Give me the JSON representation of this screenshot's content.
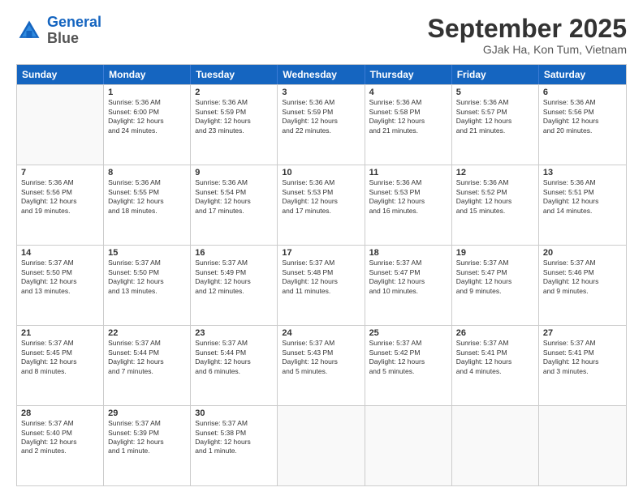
{
  "header": {
    "logo_line1": "General",
    "logo_line2": "Blue",
    "month": "September 2025",
    "location": "GJak Ha, Kon Tum, Vietnam"
  },
  "weekdays": [
    "Sunday",
    "Monday",
    "Tuesday",
    "Wednesday",
    "Thursday",
    "Friday",
    "Saturday"
  ],
  "rows": [
    [
      {
        "day": "",
        "lines": []
      },
      {
        "day": "1",
        "lines": [
          "Sunrise: 5:36 AM",
          "Sunset: 6:00 PM",
          "Daylight: 12 hours",
          "and 24 minutes."
        ]
      },
      {
        "day": "2",
        "lines": [
          "Sunrise: 5:36 AM",
          "Sunset: 5:59 PM",
          "Daylight: 12 hours",
          "and 23 minutes."
        ]
      },
      {
        "day": "3",
        "lines": [
          "Sunrise: 5:36 AM",
          "Sunset: 5:59 PM",
          "Daylight: 12 hours",
          "and 22 minutes."
        ]
      },
      {
        "day": "4",
        "lines": [
          "Sunrise: 5:36 AM",
          "Sunset: 5:58 PM",
          "Daylight: 12 hours",
          "and 21 minutes."
        ]
      },
      {
        "day": "5",
        "lines": [
          "Sunrise: 5:36 AM",
          "Sunset: 5:57 PM",
          "Daylight: 12 hours",
          "and 21 minutes."
        ]
      },
      {
        "day": "6",
        "lines": [
          "Sunrise: 5:36 AM",
          "Sunset: 5:56 PM",
          "Daylight: 12 hours",
          "and 20 minutes."
        ]
      }
    ],
    [
      {
        "day": "7",
        "lines": [
          "Sunrise: 5:36 AM",
          "Sunset: 5:56 PM",
          "Daylight: 12 hours",
          "and 19 minutes."
        ]
      },
      {
        "day": "8",
        "lines": [
          "Sunrise: 5:36 AM",
          "Sunset: 5:55 PM",
          "Daylight: 12 hours",
          "and 18 minutes."
        ]
      },
      {
        "day": "9",
        "lines": [
          "Sunrise: 5:36 AM",
          "Sunset: 5:54 PM",
          "Daylight: 12 hours",
          "and 17 minutes."
        ]
      },
      {
        "day": "10",
        "lines": [
          "Sunrise: 5:36 AM",
          "Sunset: 5:53 PM",
          "Daylight: 12 hours",
          "and 17 minutes."
        ]
      },
      {
        "day": "11",
        "lines": [
          "Sunrise: 5:36 AM",
          "Sunset: 5:53 PM",
          "Daylight: 12 hours",
          "and 16 minutes."
        ]
      },
      {
        "day": "12",
        "lines": [
          "Sunrise: 5:36 AM",
          "Sunset: 5:52 PM",
          "Daylight: 12 hours",
          "and 15 minutes."
        ]
      },
      {
        "day": "13",
        "lines": [
          "Sunrise: 5:36 AM",
          "Sunset: 5:51 PM",
          "Daylight: 12 hours",
          "and 14 minutes."
        ]
      }
    ],
    [
      {
        "day": "14",
        "lines": [
          "Sunrise: 5:37 AM",
          "Sunset: 5:50 PM",
          "Daylight: 12 hours",
          "and 13 minutes."
        ]
      },
      {
        "day": "15",
        "lines": [
          "Sunrise: 5:37 AM",
          "Sunset: 5:50 PM",
          "Daylight: 12 hours",
          "and 13 minutes."
        ]
      },
      {
        "day": "16",
        "lines": [
          "Sunrise: 5:37 AM",
          "Sunset: 5:49 PM",
          "Daylight: 12 hours",
          "and 12 minutes."
        ]
      },
      {
        "day": "17",
        "lines": [
          "Sunrise: 5:37 AM",
          "Sunset: 5:48 PM",
          "Daylight: 12 hours",
          "and 11 minutes."
        ]
      },
      {
        "day": "18",
        "lines": [
          "Sunrise: 5:37 AM",
          "Sunset: 5:47 PM",
          "Daylight: 12 hours",
          "and 10 minutes."
        ]
      },
      {
        "day": "19",
        "lines": [
          "Sunrise: 5:37 AM",
          "Sunset: 5:47 PM",
          "Daylight: 12 hours",
          "and 9 minutes."
        ]
      },
      {
        "day": "20",
        "lines": [
          "Sunrise: 5:37 AM",
          "Sunset: 5:46 PM",
          "Daylight: 12 hours",
          "and 9 minutes."
        ]
      }
    ],
    [
      {
        "day": "21",
        "lines": [
          "Sunrise: 5:37 AM",
          "Sunset: 5:45 PM",
          "Daylight: 12 hours",
          "and 8 minutes."
        ]
      },
      {
        "day": "22",
        "lines": [
          "Sunrise: 5:37 AM",
          "Sunset: 5:44 PM",
          "Daylight: 12 hours",
          "and 7 minutes."
        ]
      },
      {
        "day": "23",
        "lines": [
          "Sunrise: 5:37 AM",
          "Sunset: 5:44 PM",
          "Daylight: 12 hours",
          "and 6 minutes."
        ]
      },
      {
        "day": "24",
        "lines": [
          "Sunrise: 5:37 AM",
          "Sunset: 5:43 PM",
          "Daylight: 12 hours",
          "and 5 minutes."
        ]
      },
      {
        "day": "25",
        "lines": [
          "Sunrise: 5:37 AM",
          "Sunset: 5:42 PM",
          "Daylight: 12 hours",
          "and 5 minutes."
        ]
      },
      {
        "day": "26",
        "lines": [
          "Sunrise: 5:37 AM",
          "Sunset: 5:41 PM",
          "Daylight: 12 hours",
          "and 4 minutes."
        ]
      },
      {
        "day": "27",
        "lines": [
          "Sunrise: 5:37 AM",
          "Sunset: 5:41 PM",
          "Daylight: 12 hours",
          "and 3 minutes."
        ]
      }
    ],
    [
      {
        "day": "28",
        "lines": [
          "Sunrise: 5:37 AM",
          "Sunset: 5:40 PM",
          "Daylight: 12 hours",
          "and 2 minutes."
        ]
      },
      {
        "day": "29",
        "lines": [
          "Sunrise: 5:37 AM",
          "Sunset: 5:39 PM",
          "Daylight: 12 hours",
          "and 1 minute."
        ]
      },
      {
        "day": "30",
        "lines": [
          "Sunrise: 5:37 AM",
          "Sunset: 5:38 PM",
          "Daylight: 12 hours",
          "and 1 minute."
        ]
      },
      {
        "day": "",
        "lines": []
      },
      {
        "day": "",
        "lines": []
      },
      {
        "day": "",
        "lines": []
      },
      {
        "day": "",
        "lines": []
      }
    ]
  ]
}
